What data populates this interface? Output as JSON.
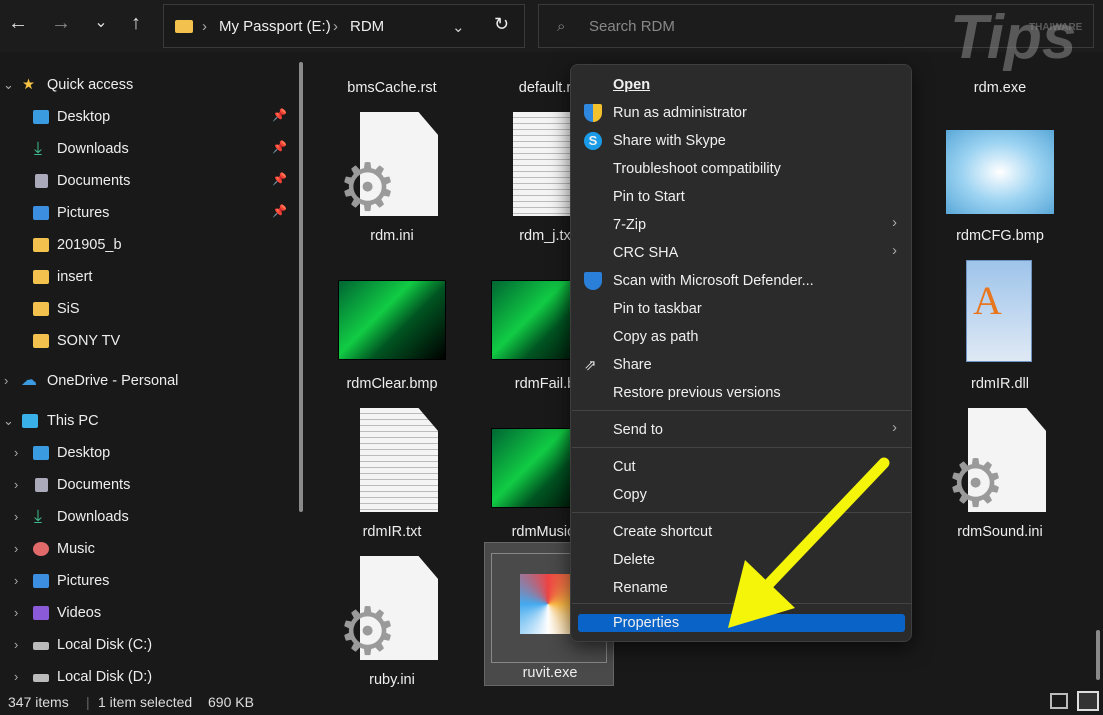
{
  "toolbar": {
    "back": "←",
    "forward": "→",
    "recent": "⌄",
    "up": "↑",
    "breadcrumb": [
      "My Passport (E:)",
      "RDM"
    ],
    "sep": "›",
    "search_placeholder": "Search RDM",
    "refresh": "↻",
    "dropdown": "⌄"
  },
  "sidebar": {
    "quick_access": "Quick access",
    "quick_items": [
      "Desktop",
      "Downloads",
      "Documents",
      "Pictures",
      "201905_b",
      "insert",
      "SiS",
      "SONY TV"
    ],
    "onedrive": "OneDrive - Personal",
    "this_pc": "This PC",
    "pc_items": [
      "Desktop",
      "Documents",
      "Downloads",
      "Music",
      "Pictures",
      "Videos",
      "Local Disk (C:)",
      "Local Disk (D:)"
    ]
  },
  "files": [
    "bmsCache.rst",
    "default.r",
    "rdm.exe",
    "rdm.ini",
    "rdm_j.tx",
    "rdmCFG.bmp",
    "rdmClear.bmp",
    "rdmFail.b",
    "rdmIR.dll",
    "rdmIR.txt",
    "rdmMusic.",
    "rdmSound.ini",
    "ruby.ini",
    "ruvit.exe"
  ],
  "context_menu": {
    "items": [
      "Open",
      "Run as administrator",
      "Share with Skype",
      "Troubleshoot compatibility",
      "Pin to Start",
      "7-Zip",
      "CRC SHA",
      "Scan with Microsoft Defender...",
      "Pin to taskbar",
      "Copy as path",
      "Share",
      "Restore previous versions",
      "Send to",
      "Cut",
      "Copy",
      "Create shortcut",
      "Delete",
      "Rename",
      "Properties"
    ],
    "submenu_arrow": "›",
    "highlighted": "Properties"
  },
  "status": {
    "count": "347 items",
    "selected": "1 item selected",
    "size": "690 KB"
  },
  "watermark": "THAIWARE Tips",
  "colors": {
    "accent": "#0a64c8",
    "arrow": "#f5f50a"
  }
}
